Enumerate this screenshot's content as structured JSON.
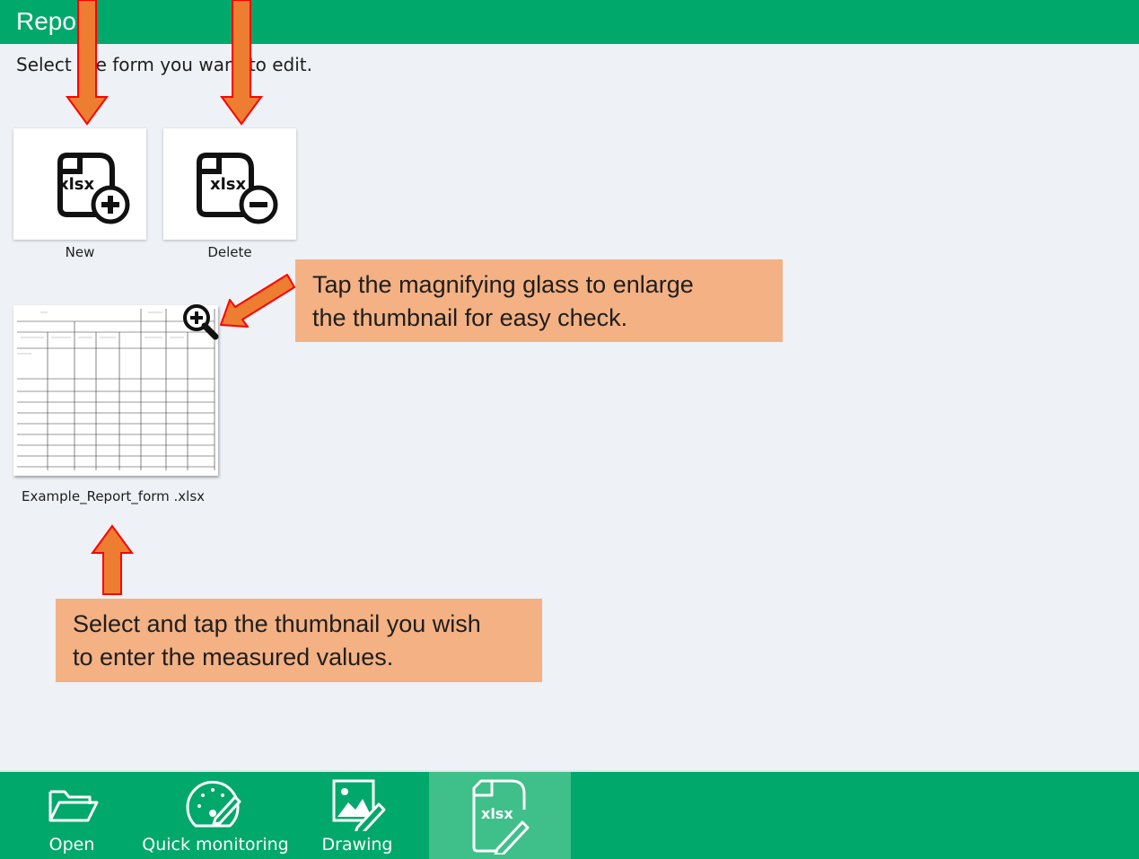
{
  "header": {
    "title": "Report"
  },
  "instruction": "Select the form you want to edit.",
  "actions": {
    "new_label": "New",
    "new_icon_text": "xlsx",
    "delete_label": "Delete",
    "delete_icon_text": "xlsx"
  },
  "forms": [
    {
      "file_name": "Example_Report_form .xlsx"
    }
  ],
  "callouts": {
    "magnify": {
      "line1": "Tap the magnifying glass to enlarge",
      "line2": "the thumbnail for easy check."
    },
    "select": {
      "line1": "Select and tap the thumbnail you wish",
      "line2": "to enter the measured values."
    }
  },
  "nav": {
    "items": [
      {
        "label": "Open",
        "icon": "folder-icon"
      },
      {
        "label": "Quick monitoring",
        "icon": "gauge-icon"
      },
      {
        "label": "Drawing",
        "icon": "drawing-icon"
      },
      {
        "label": "",
        "icon": "xlsx-edit-icon",
        "icon_text": "xlsx",
        "active": true
      }
    ]
  },
  "colors": {
    "brand_green": "#00a86b",
    "active_tab": "#3fbf8a",
    "callout_fill": "#f4b183",
    "arrow_fill": "#ed7d31",
    "arrow_border": "#ff0000"
  }
}
